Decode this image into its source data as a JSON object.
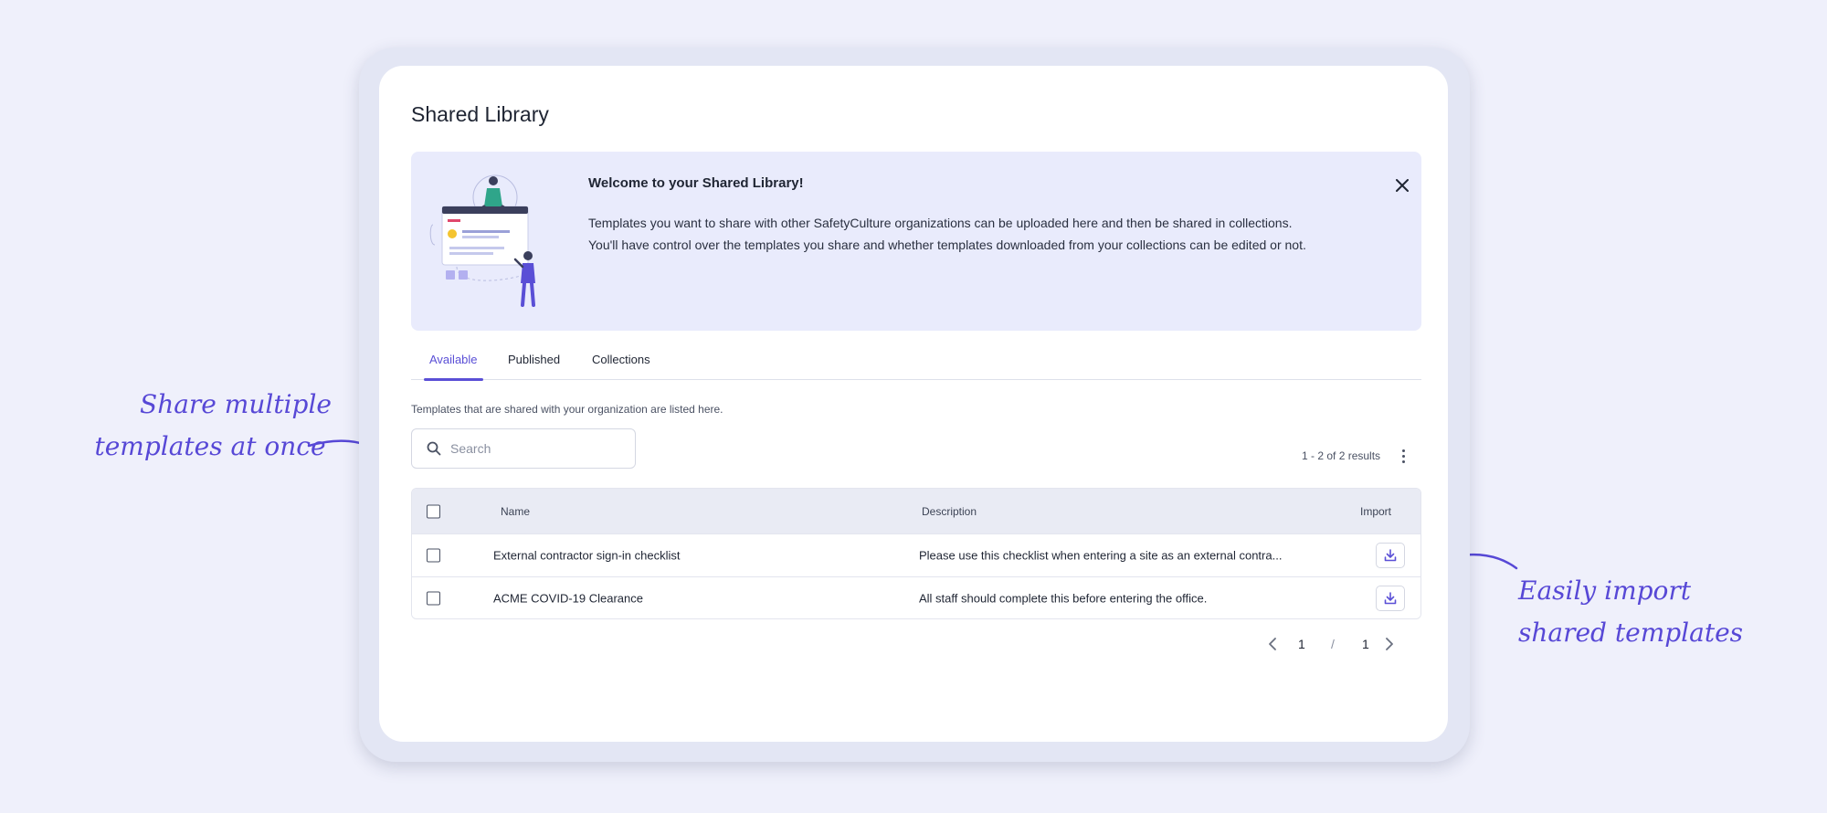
{
  "page_title": "Shared Library",
  "banner": {
    "title": "Welcome to your Shared Library!",
    "line1": "Templates you want to share with other SafetyCulture organizations can be uploaded here and then be shared in collections.",
    "line2": "You'll have control over the templates you share and whether templates downloaded from your collections can be edited or not."
  },
  "tabs": [
    {
      "label": "Available",
      "active": true
    },
    {
      "label": "Published",
      "active": false
    },
    {
      "label": "Collections",
      "active": false
    }
  ],
  "intro_text": "Templates that are shared with your organization are listed here.",
  "search": {
    "placeholder": "Search",
    "value": ""
  },
  "results_text": "1 - 2 of 2 results",
  "table": {
    "headers": {
      "name": "Name",
      "description": "Description",
      "import": "Import"
    },
    "rows": [
      {
        "name": "External contractor sign-in checklist",
        "description": "Please use this checklist when entering a site as an external contra..."
      },
      {
        "name": "ACME COVID-19 Clearance",
        "description": "All staff should complete this before entering the office."
      }
    ]
  },
  "pagination": {
    "current": "1",
    "separator": "/",
    "total": "1"
  },
  "annotations": {
    "left_line1": "Share multiple",
    "left_line2": "templates at once",
    "right_line1": "Easily import",
    "right_line2": "shared templates"
  },
  "colors": {
    "accent": "#5a4fd6",
    "banner_bg": "#e9ebfc",
    "page_bg": "#eff0fb",
    "annotation": "#5748d6"
  }
}
